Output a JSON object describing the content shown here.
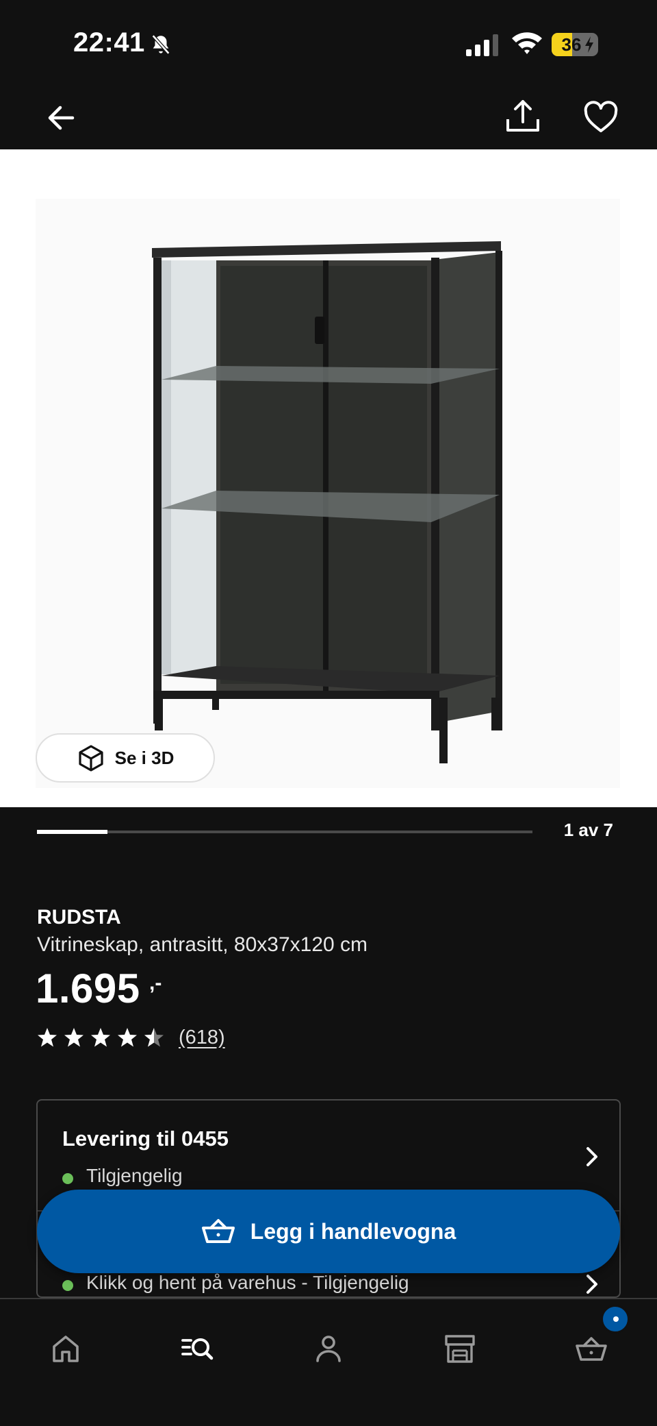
{
  "status_bar": {
    "time": "22:41",
    "battery_level": "36",
    "icons": [
      "bell-slash-icon",
      "signal-icon",
      "wifi-icon",
      "battery-icon"
    ]
  },
  "top_nav": {
    "icons": [
      "arrow-left-icon",
      "share-icon",
      "heart-icon"
    ]
  },
  "gallery": {
    "view_3d_label": "Se i 3D",
    "current_index": 1,
    "total": 7,
    "counter_text": "1 av 7"
  },
  "product": {
    "name": "RUDSTA",
    "description": "Vitrineskap, antrasitt, 80x37x120 cm",
    "price": "1.695",
    "price_suffix": ",-",
    "rating": 4.5,
    "review_count": "(618)"
  },
  "delivery": {
    "title": "Levering til 0455",
    "delivery_status": "Tilgjengelig",
    "pickup_status": "Klikk og hent på varehus - Tilgjengelig"
  },
  "cta": {
    "add_to_cart_label": "Legg i handlevogna"
  },
  "bottom_nav": {
    "items": [
      "home-icon",
      "search-icon",
      "account-icon",
      "store-icon",
      "cart-icon"
    ],
    "cart_badge": true
  },
  "colors": {
    "background": "#111111",
    "accent": "#0058a3",
    "available": "#6bbf59",
    "battery": "#f5d21c"
  }
}
